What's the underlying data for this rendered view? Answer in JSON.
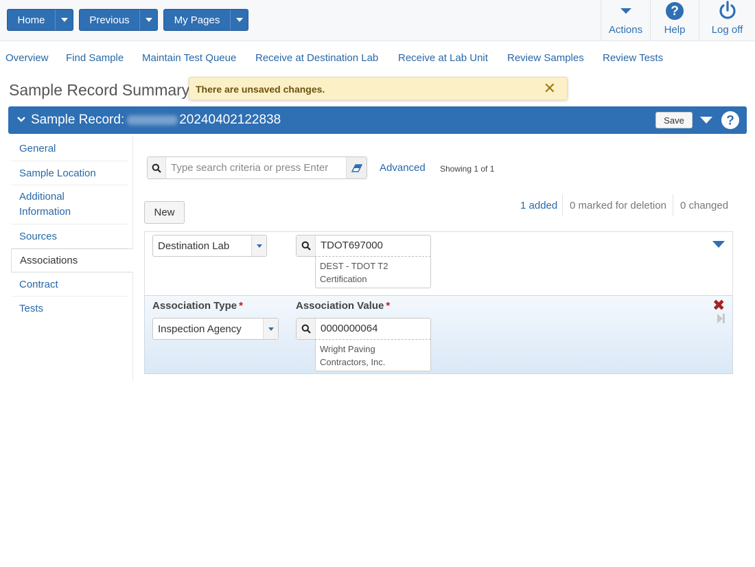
{
  "topbar": {
    "home_label": "Home",
    "previous_label": "Previous",
    "mypages_label": "My Pages",
    "actions_label": "Actions",
    "help_label": "Help",
    "logoff_label": "Log off"
  },
  "tabs": [
    "Overview",
    "Find Sample",
    "Maintain Test Queue",
    "Receive at Destination Lab",
    "Receive at Lab Unit",
    "Review Samples",
    "Review Tests"
  ],
  "page_title": "Sample Record Summary",
  "toast": {
    "message": "There are unsaved changes.",
    "close_glyph": "✕"
  },
  "record": {
    "label": "Sample Record:",
    "id": "20240402122838",
    "save_label": "Save"
  },
  "leftnav": [
    "General",
    "Sample Location",
    "Additional Information",
    "Sources",
    "Associations",
    "Contract",
    "Tests"
  ],
  "leftnav_active": "Associations",
  "search": {
    "placeholder": "Type search criteria or press Enter",
    "advanced_label": "Advanced",
    "showing": "Showing 1 of 1"
  },
  "toolbar": {
    "new_label": "New",
    "added": "1 added",
    "marked": "0 marked for deletion",
    "changed": "0 changed"
  },
  "rows": [
    {
      "type": "Destination Lab",
      "value": "TDOT697000",
      "desc_line1": "DEST - TDOT T2",
      "desc_line2": "Certification"
    },
    {
      "type_label": "Association Type",
      "value_label": "Association Value",
      "type": "Inspection Agency",
      "value": "0000000064",
      "desc_line1": "Wright Paving",
      "desc_line2": "Contractors, Inc."
    }
  ],
  "colors": {
    "primary": "#2f6fb3",
    "link": "#2768a7",
    "toast_bg": "#fcf0c6",
    "required": "#c0171c"
  }
}
